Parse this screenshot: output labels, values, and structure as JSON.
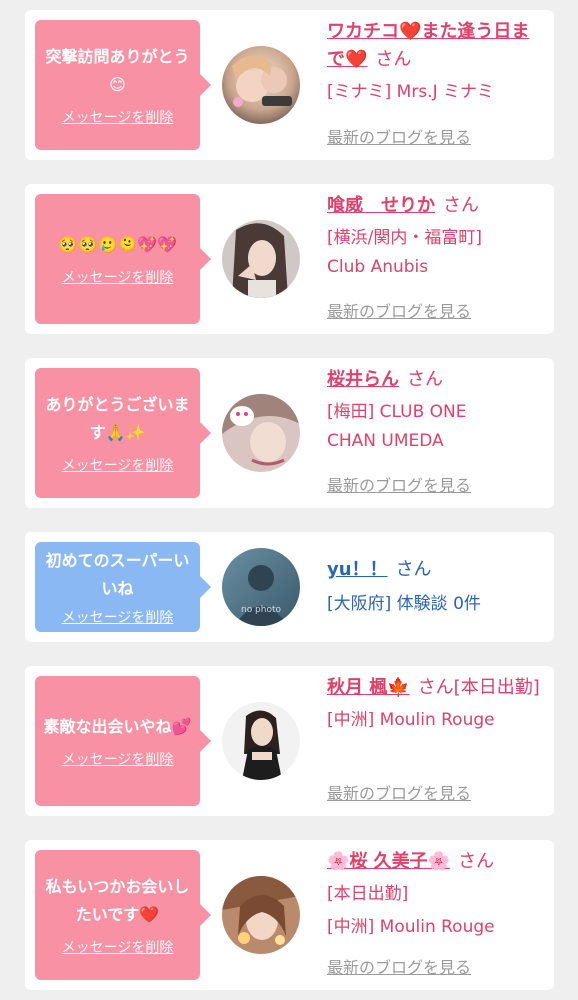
{
  "cards": [
    {
      "message": "突撃訪問ありがとう😊",
      "delete_label": "メッセージを削除",
      "name": "ワカチコ❤️また逢う日まで❤️",
      "honorific": "さん",
      "shop": "[ミナミ] Mrs.J ミナミ",
      "blog_label": "最新のブログを見る",
      "color": "#f791a3"
    },
    {
      "message": "🥺🥺🥲🫠💖💖",
      "delete_label": "メッセージを削除",
      "name": "喰威　せりか",
      "honorific": "さん",
      "shop": "[横浜/関内・福富町] Club Anubis",
      "blog_label": "最新のブログを見る",
      "color": "#f791a3"
    },
    {
      "message": "ありがとうございます🙏✨",
      "delete_label": "メッセージを削除",
      "name": "桜井らん",
      "honorific": "さん",
      "shop": "[梅田] CLUB ONE CHAN UMEDA",
      "blog_label": "最新のブログを見る",
      "color": "#f791a3"
    },
    {
      "message": "初めてのスーパーいいね",
      "delete_label": "メッセージを削除",
      "name": "yu！！",
      "honorific": "さん",
      "shop": "[大阪府] 体験談 0件",
      "avatar_text": "no photo",
      "color": "#8ab8f2"
    },
    {
      "message": "素敵な出会いやね💕",
      "delete_label": "メッセージを削除",
      "name": "秋月 楓🍁",
      "honorific": "さん[本日出勤]",
      "shop": "[中洲] Moulin Rouge",
      "blog_label": "最新のブログを見る",
      "color": "#f791a3"
    },
    {
      "message": "私もいつかお会いしたいです❤️",
      "delete_label": "メッセージを削除",
      "name": "🌸桜 久美子🌸",
      "honorific": "さん",
      "status": "[本日出勤]",
      "shop": "[中洲] Moulin Rouge",
      "blog_label": "最新のブログを見る",
      "color": "#f791a3"
    }
  ]
}
